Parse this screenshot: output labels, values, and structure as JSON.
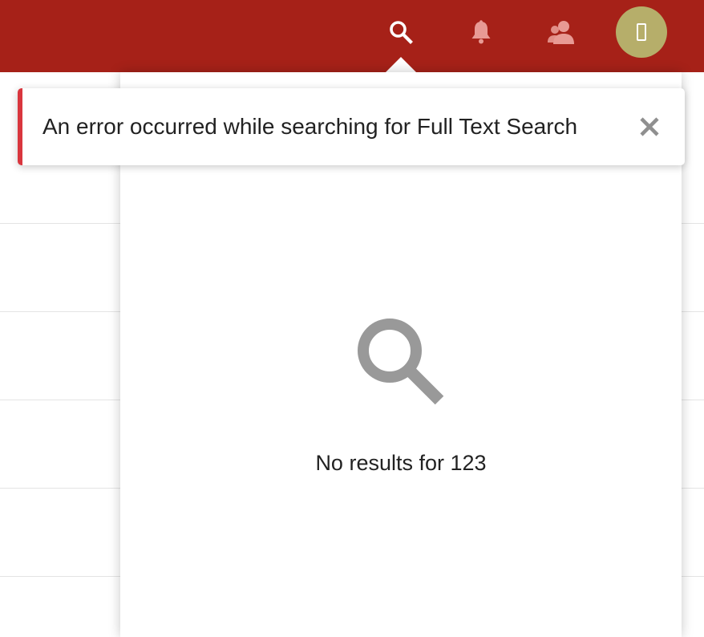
{
  "header": {
    "background_color": "#a62118",
    "icons": {
      "search": "search-icon",
      "notifications": "bell-icon",
      "users": "users-icon",
      "avatar": "avatar-glyph-icon"
    },
    "avatar_color": "#b6ae6a"
  },
  "toast": {
    "message": "An error occurred while searching for Full Text Search",
    "accent_color": "#d9363e",
    "close_icon": "close-icon"
  },
  "search_panel": {
    "empty_icon": "search-icon",
    "empty_message": "No results for 123"
  }
}
